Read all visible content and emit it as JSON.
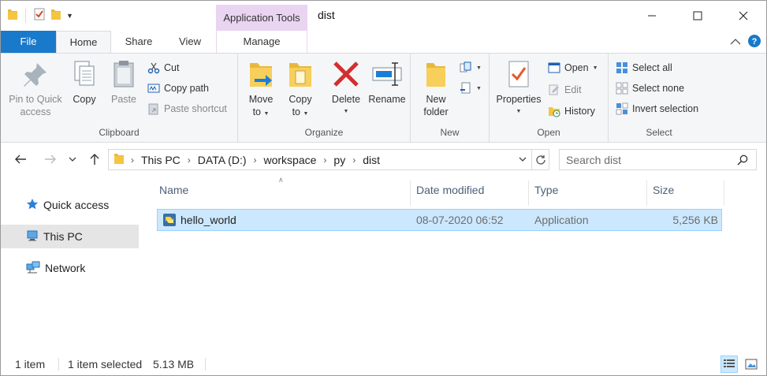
{
  "window": {
    "title": "dist",
    "context_tab": "Application Tools"
  },
  "tabs": {
    "file": "File",
    "home": "Home",
    "share": "Share",
    "view": "View",
    "manage": "Manage"
  },
  "ribbon": {
    "clipboard": {
      "label": "Clipboard",
      "pin_line1": "Pin to Quick",
      "pin_line2": "access",
      "copy": "Copy",
      "paste": "Paste",
      "cut": "Cut",
      "copy_path": "Copy path",
      "paste_shortcut": "Paste shortcut"
    },
    "organize": {
      "label": "Organize",
      "move_line1": "Move",
      "move_line2": "to",
      "copyto_line1": "Copy",
      "copyto_line2": "to",
      "delete": "Delete",
      "rename": "Rename"
    },
    "new": {
      "label": "New",
      "folder_line1": "New",
      "folder_line2": "folder"
    },
    "open": {
      "label": "Open",
      "properties": "Properties",
      "open": "Open",
      "edit": "Edit",
      "history": "History"
    },
    "select": {
      "label": "Select",
      "select_all": "Select all",
      "select_none": "Select none",
      "invert": "Invert selection"
    }
  },
  "address": {
    "crumbs": [
      "This PC",
      "DATA (D:)",
      "workspace",
      "py",
      "dist"
    ]
  },
  "search": {
    "placeholder": "Search dist"
  },
  "navpane": {
    "items": [
      {
        "label": "Quick access",
        "icon": "star-icon"
      },
      {
        "label": "This PC",
        "icon": "computer-icon"
      },
      {
        "label": "Network",
        "icon": "network-icon"
      }
    ]
  },
  "columns": [
    "Name",
    "Date modified",
    "Type",
    "Size"
  ],
  "files": [
    {
      "name": "hello_world",
      "date": "08-07-2020 06:52",
      "type": "Application",
      "size": "5,256 KB"
    }
  ],
  "status": {
    "count": "1 item",
    "selected": "1 item selected",
    "size": "5.13 MB"
  },
  "colors": {
    "accent": "#1979ca",
    "context_tab": "#e9d4f1",
    "selection": "#cce8ff",
    "selection_border": "#99d1ff",
    "delete_red": "#d32f2f",
    "folder_yellow": "#f5c542"
  }
}
